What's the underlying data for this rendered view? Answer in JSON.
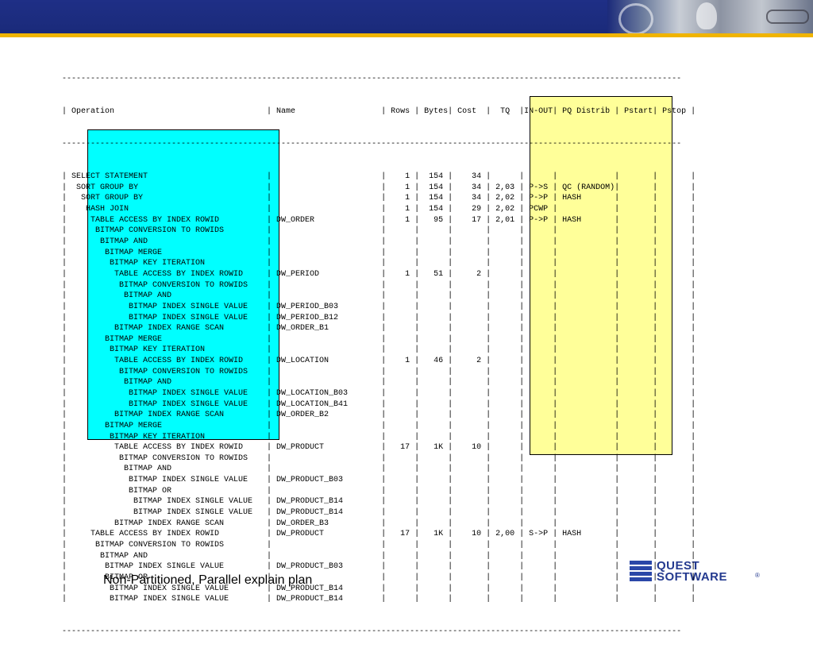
{
  "slide": {
    "caption": "Non-Partitioned, Parallel explain plan"
  },
  "branding": {
    "logo_line1": "QUEST",
    "logo_line2": "SOFTWARE",
    "logo_reg": "®",
    "colors": {
      "header": "#1f2f86",
      "accent": "#f0b400",
      "cyan_highlight": "#00ffff",
      "yellow_highlight": "#ffff99"
    }
  },
  "plan": {
    "separator": "----------------------------------------------------------------------------------------------------------------------------------",
    "header": "| Operation                                | Name                  | Rows | Bytes| Cost  |  TQ  |IN-OUT| PQ Distrib | Pstart| Pstop |",
    "rows": [
      "| SELECT STATEMENT                         |                       |    1 |  154 |    34 |      |      |            |       |       |",
      "|  SORT GROUP BY                           |                       |    1 |  154 |    34 | 2,03 | P->S | QC (RANDOM)|       |       |",
      "|   SORT GROUP BY                          |                       |    1 |  154 |    34 | 2,02 | P->P | HASH       |       |       |",
      "|    HASH JOIN                             |                       |    1 |  154 |    29 | 2,02 | PCWP |            |       |       |",
      "|     TABLE ACCESS BY INDEX ROWID          | DW_ORDER              |    1 |   95 |    17 | 2,01 | P->P | HASH       |       |       |",
      "|      BITMAP CONVERSION TO ROWIDS         |                       |      |      |       |      |      |            |       |       |",
      "|       BITMAP AND                         |                       |      |      |       |      |      |            |       |       |",
      "|        BITMAP MERGE                      |                       |      |      |       |      |      |            |       |       |",
      "|         BITMAP KEY ITERATION             |                       |      |      |       |      |      |            |       |       |",
      "|          TABLE ACCESS BY INDEX ROWID     | DW_PERIOD             |    1 |   51 |     2 |      |      |            |       |       |",
      "|           BITMAP CONVERSION TO ROWIDS    |                       |      |      |       |      |      |            |       |       |",
      "|            BITMAP AND                    |                       |      |      |       |      |      |            |       |       |",
      "|             BITMAP INDEX SINGLE VALUE    | DW_PERIOD_B03         |      |      |       |      |      |            |       |       |",
      "|             BITMAP INDEX SINGLE VALUE    | DW_PERIOD_B12         |      |      |       |      |      |            |       |       |",
      "|          BITMAP INDEX RANGE SCAN         | DW_ORDER_B1           |      |      |       |      |      |            |       |       |",
      "|        BITMAP MERGE                      |                       |      |      |       |      |      |            |       |       |",
      "|         BITMAP KEY ITERATION             |                       |      |      |       |      |      |            |       |       |",
      "|          TABLE ACCESS BY INDEX ROWID     | DW_LOCATION           |    1 |   46 |     2 |      |      |            |       |       |",
      "|           BITMAP CONVERSION TO ROWIDS    |                       |      |      |       |      |      |            |       |       |",
      "|            BITMAP AND                    |                       |      |      |       |      |      |            |       |       |",
      "|             BITMAP INDEX SINGLE VALUE    | DW_LOCATION_B03       |      |      |       |      |      |            |       |       |",
      "|             BITMAP INDEX SINGLE VALUE    | DW_LOCATION_B41       |      |      |       |      |      |            |       |       |",
      "|          BITMAP INDEX RANGE SCAN         | DW_ORDER_B2           |      |      |       |      |      |            |       |       |",
      "|        BITMAP MERGE                      |                       |      |      |       |      |      |            |       |       |",
      "|         BITMAP KEY ITERATION             |                       |      |      |       |      |      |            |       |       |",
      "|          TABLE ACCESS BY INDEX ROWID     | DW_PRODUCT            |   17 |   1K |    10 |      |      |            |       |       |",
      "|           BITMAP CONVERSION TO ROWIDS    |                       |      |      |       |      |      |            |       |       |",
      "|            BITMAP AND                    |                       |      |      |       |      |      |            |       |       |",
      "|             BITMAP INDEX SINGLE VALUE    | DW_PRODUCT_B03        |      |      |       |      |      |            |       |       |",
      "|             BITMAP OR                    |                       |      |      |       |      |      |            |       |       |",
      "|              BITMAP INDEX SINGLE VALUE   | DW_PRODUCT_B14        |      |      |       |      |      |            |       |       |",
      "|              BITMAP INDEX SINGLE VALUE   | DW_PRODUCT_B14        |      |      |       |      |      |            |       |       |",
      "|          BITMAP INDEX RANGE SCAN         | DW_ORDER_B3           |      |      |       |      |      |            |       |       |",
      "|     TABLE ACCESS BY INDEX ROWID          | DW_PRODUCT            |   17 |   1K |    10 | 2,00 | S->P | HASH       |       |       |",
      "|      BITMAP CONVERSION TO ROWIDS         |                       |      |      |       |      |      |            |       |       |",
      "|       BITMAP AND                         |                       |      |      |       |      |      |            |       |       |",
      "|        BITMAP INDEX SINGLE VALUE         | DW_PRODUCT_B03        |      |      |       |      |      |            |       |       |",
      "|        BITMAP OR                         |                       |      |      |       |      |      |            |       |       |",
      "|         BITMAP INDEX SINGLE VALUE        | DW_PRODUCT_B14        |      |      |       |      |      |            |       |       |",
      "|         BITMAP INDEX SINGLE VALUE        | DW_PRODUCT_B14        |      |      |       |      |      |            |       |       |"
    ]
  }
}
